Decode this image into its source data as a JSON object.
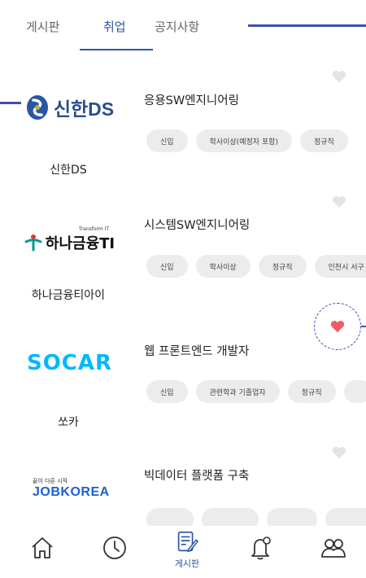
{
  "tabs": [
    {
      "label": "게시판",
      "active": false
    },
    {
      "label": "취업",
      "active": true
    },
    {
      "label": "공지사항",
      "active": false
    }
  ],
  "jobs": [
    {
      "company": "신한DS",
      "logo_text": "신한DS",
      "title": "응용SW엔지니어링",
      "tags": [
        "신입",
        "학사이상(예정자 포함)",
        "정규직"
      ],
      "liked": false
    },
    {
      "company": "하나금융티아이",
      "logo_text": "하나금융TI",
      "logo_subtext": "Transform IT",
      "title": "시스템SW엔지니어링",
      "tags": [
        "신입",
        "학사이상",
        "정규직",
        "인천시 서구"
      ],
      "liked": false
    },
    {
      "company": "쏘카",
      "logo_text": "SOCAR",
      "title": "웹 프론트엔드 개발자",
      "tags": [
        "신입",
        "관련학과 기졸업자",
        "정규직",
        ""
      ],
      "liked": true
    },
    {
      "company": "",
      "logo_text": "JOBKOREA",
      "logo_subtext": "끝이 다른 시작",
      "title": "빅데이터 플랫폼 구축",
      "tags": [
        "",
        "",
        "",
        ""
      ],
      "liked": false
    }
  ],
  "bottom_nav": [
    {
      "icon": "home-icon",
      "label": ""
    },
    {
      "icon": "clock-icon",
      "label": ""
    },
    {
      "icon": "board-icon",
      "label": "게시판",
      "active": true
    },
    {
      "icon": "bell-icon",
      "label": ""
    },
    {
      "icon": "people-icon",
      "label": ""
    }
  ],
  "colors": {
    "accent": "#2a56a6",
    "heart_inactive": "#e4e4e4",
    "heart_active": "#ef5a64",
    "chip_bg": "#ececec",
    "annotation": "#3d4fb0"
  }
}
